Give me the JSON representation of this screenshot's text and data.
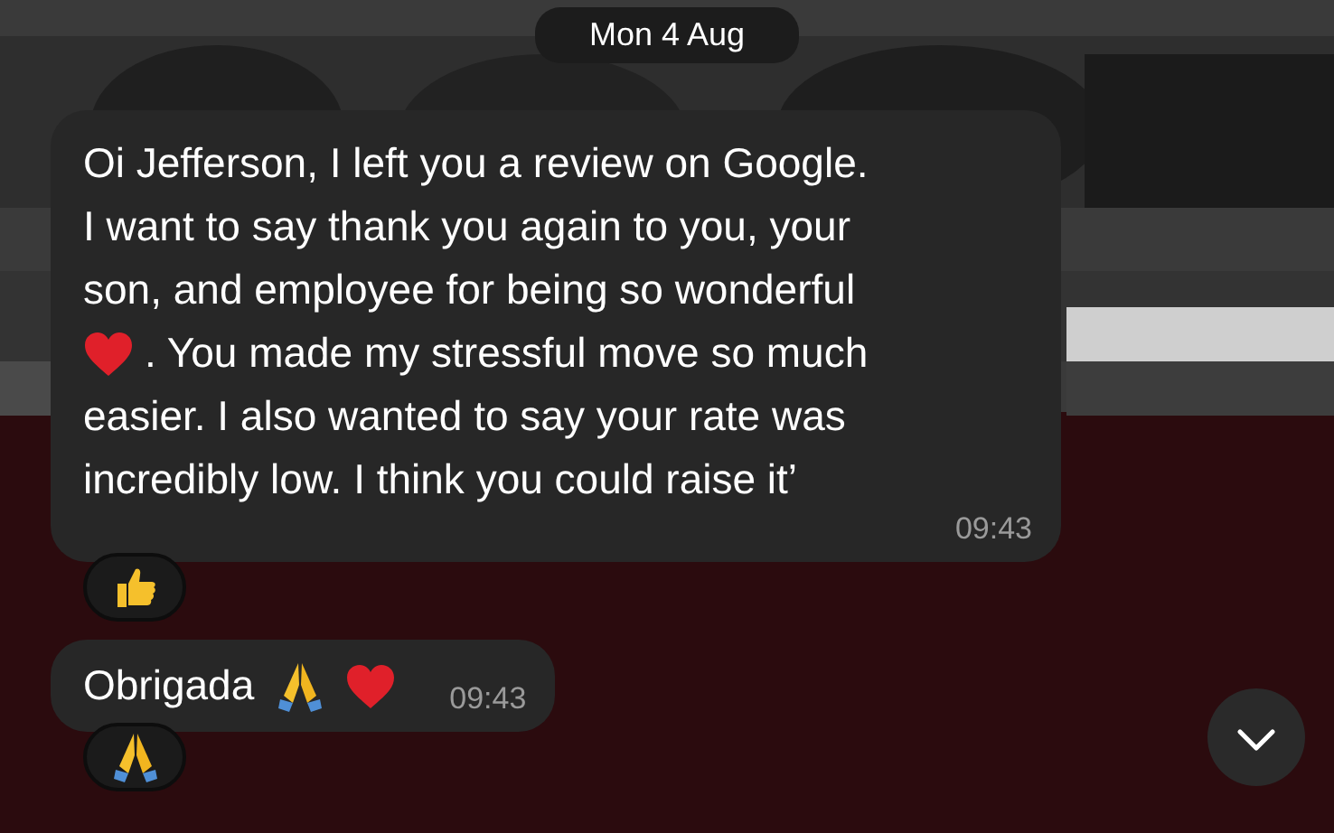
{
  "date_divider": "Mon 4 Aug",
  "messages": [
    {
      "lines": [
        [
          {
            "kind": "text",
            "text": "Oi Jefferson, I left you a review on Google."
          }
        ],
        [
          {
            "kind": "text",
            "text": "I want to say thank you again to you, your"
          }
        ],
        [
          {
            "kind": "text",
            "text": "son, and employee for being so wonderful"
          }
        ],
        [
          {
            "kind": "heart"
          },
          {
            "kind": "text",
            "text": ". You made my stressful move so much"
          }
        ],
        [
          {
            "kind": "text",
            "text": "easier. I also wanted to say your rate was"
          }
        ],
        [
          {
            "kind": "text",
            "text": "incredibly low. I think you could raise it’"
          }
        ]
      ],
      "time": "09:43",
      "reactions": [
        {
          "kind": "thumbs-up"
        }
      ]
    },
    {
      "lines": [
        [
          {
            "kind": "text",
            "text": "Obrigada"
          },
          {
            "kind": "pray"
          },
          {
            "kind": "heart"
          }
        ]
      ],
      "time": "09:43",
      "reactions": [
        {
          "kind": "pray"
        }
      ]
    }
  ],
  "scroll_down_button": {
    "kind": "chevron-down"
  }
}
